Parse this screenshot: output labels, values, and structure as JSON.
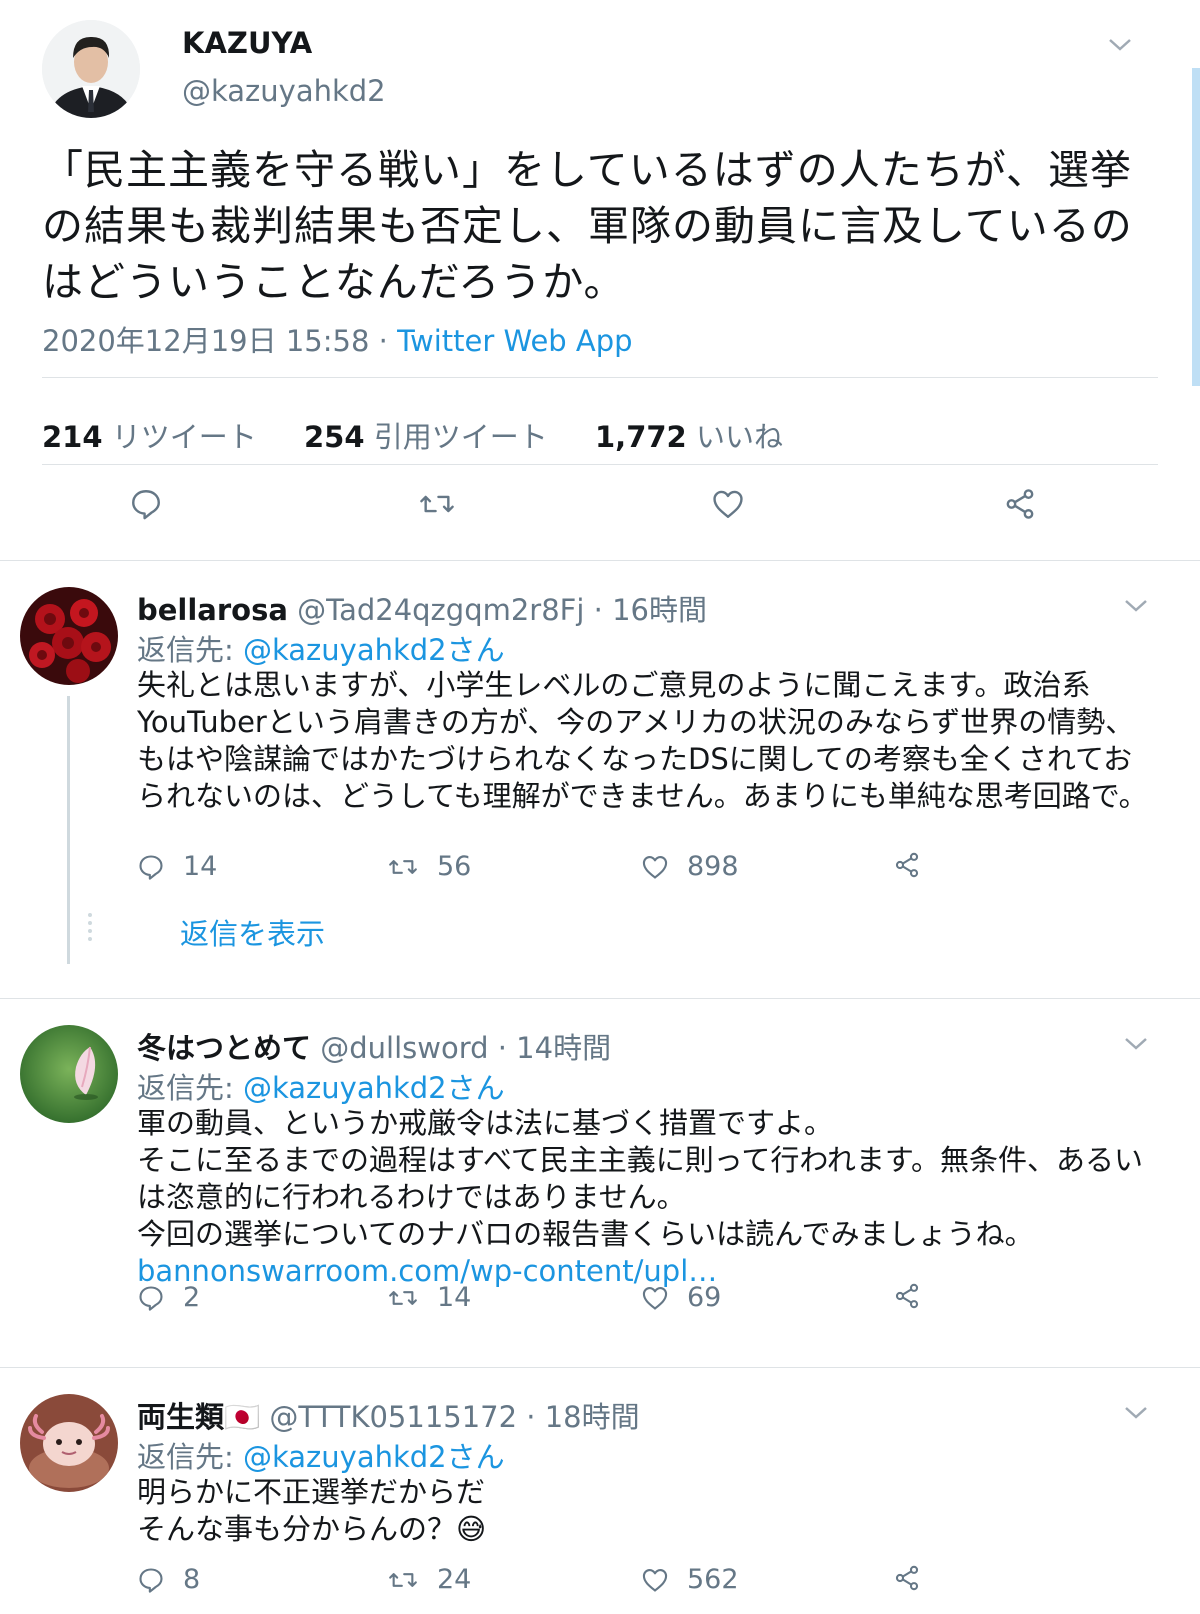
{
  "main_tweet": {
    "name": "KAZUYA",
    "handle": "@kazuyahkd2",
    "text": "「民主主義を守る戦い」をしているはずの人たちが、選挙の結果も裁判結果も否定し、軍隊の動員に言及しているのはどういうことなんだろうか。",
    "timestamp": "2020年12月19日 15:58",
    "separator": " · ",
    "source": "Twitter Web App",
    "stats": {
      "retweets_count": "214",
      "retweets_label": "リツイート",
      "quotes_count": "254",
      "quotes_label": "引用ツイート",
      "likes_count": "1,772",
      "likes_label": "いいね"
    },
    "actions": [
      "reply-icon",
      "retweet-icon",
      "like-icon",
      "share-icon"
    ]
  },
  "replies": [
    {
      "name": "bellarosa",
      "handle": "@Tad24qzgqm2r8Fj",
      "time": "· 16時間",
      "reply_to_label": "返信先: ",
      "reply_to_mention": "@kazuyahkd2さん",
      "text": "失礼とは思いますが、小学生レベルのご意見のように聞こえます。政治系YouTuberという肩書きの方が、今のアメリカの状況のみならず世界の情勢、もはや陰謀論ではかたづけられなくなったDSに関しての考察も全くされておられないのは、どうしても理解ができません。あまりにも単純な思考回路で。",
      "link": "",
      "replies": "14",
      "retweets": "56",
      "likes": "898",
      "show_replies": "返信を表示"
    },
    {
      "name": "冬はつとめて",
      "handle": "@dullsword",
      "time": "· 14時間",
      "reply_to_label": "返信先: ",
      "reply_to_mention": "@kazuyahkd2さん",
      "text": "軍の動員、というか戒厳令は法に基づく措置ですよ。\nそこに至るまでの過程はすべて民主主義に則って行われます。無条件、あるいは恣意的に行われるわけではありません。\n今回の選挙についてのナバロの報告書くらいは読んでみましょうね。",
      "link": "bannonswarroom.com/wp-content/upl…",
      "replies": "2",
      "retweets": "14",
      "likes": "69"
    },
    {
      "name": "両生類🇯🇵",
      "handle": "@TTTK05115172",
      "time": "· 18時間",
      "reply_to_label": "返信先: ",
      "reply_to_mention": "@kazuyahkd2さん",
      "text": "明らかに不正選挙だからだ\nそんな事も分からんの？😅",
      "link": "",
      "replies": "8",
      "retweets": "24",
      "likes": "562"
    }
  ],
  "colors": {
    "link": "#1b95e0",
    "secondary_text": "#657786",
    "primary_text": "#14171a",
    "divider": "#dfe3e6"
  }
}
